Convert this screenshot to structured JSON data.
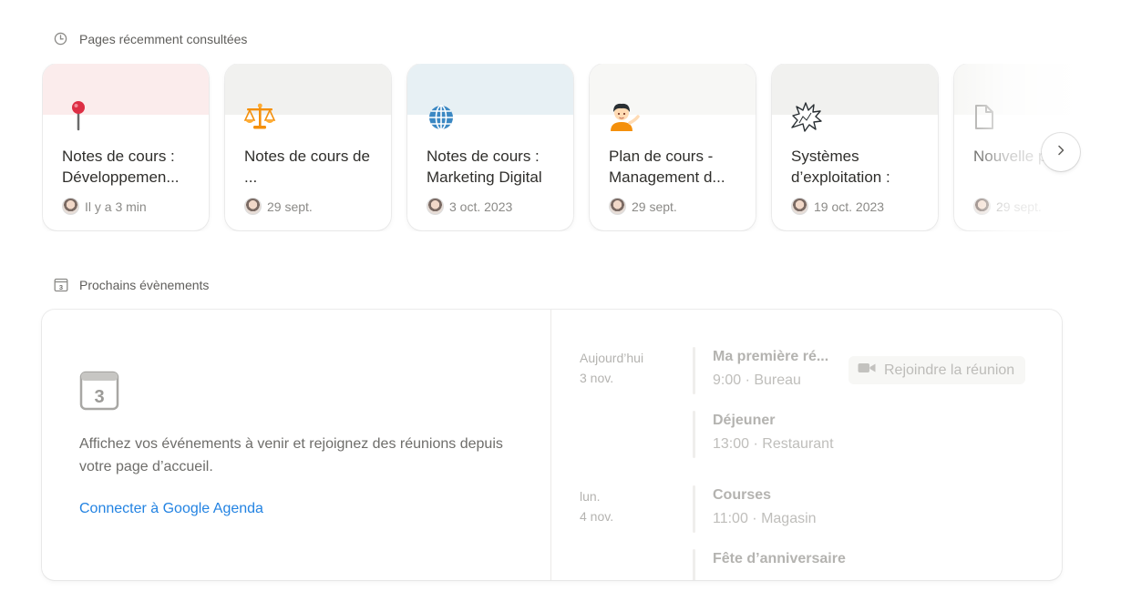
{
  "recent": {
    "header": "Pages récemment consultées",
    "header_icon": "clock-icon",
    "pages": [
      {
        "title": "Notes de cours : Développemen...",
        "meta": "Il y a 3 min",
        "cover": "#fbecec",
        "icon": "round-pushpin-icon"
      },
      {
        "title": "Notes de cours de ...",
        "meta": "29 sept.",
        "cover": "#f1f1ef",
        "icon": "balance-scale-icon"
      },
      {
        "title": "Notes de cours : Marketing Digital",
        "meta": "3 oct. 2023",
        "cover": "#e7f0f4",
        "icon": "globe-icon"
      },
      {
        "title": "Plan de cours - Management d...",
        "meta": "29 sept.",
        "cover": "#f7f7f5",
        "icon": "person-tipping-hand-icon"
      },
      {
        "title": "Systèmes d’exploitation :",
        "meta": "19 oct. 2023",
        "cover": "#f1f1ef",
        "icon": "anger-symbol-icon"
      },
      {
        "title": "Nouvelle page",
        "meta": "29 sept.",
        "cover": "#f7f7f5",
        "icon": "page-icon"
      }
    ],
    "next_icon": "chevron-right-icon"
  },
  "events": {
    "header": "Prochains évènements",
    "header_icon": "calendar-icon",
    "calendar_day": "3",
    "empty_text": "Affichez vos événements à venir et rejoignez des réunions depuis votre page d’accueil.",
    "connect_link": "Connecter à Google Agenda",
    "days": [
      {
        "label_line1": "Aujourd’hui",
        "label_line2": "3 nov.",
        "items": [
          {
            "title": "Ma première ré...",
            "sub": "9:00 · Bureau"
          },
          {
            "title": "Déjeuner",
            "sub": "13:00 · Restaurant"
          }
        ]
      },
      {
        "label_line1": "lun.",
        "label_line2": "4 nov.",
        "items": [
          {
            "title": "Courses",
            "sub": "11:00 · Magasin"
          },
          {
            "title": "Fête d’anniversaire",
            "sub": ""
          }
        ]
      }
    ],
    "join_button": "Rejoindre la réunion",
    "join_icon": "video-camera-icon"
  }
}
